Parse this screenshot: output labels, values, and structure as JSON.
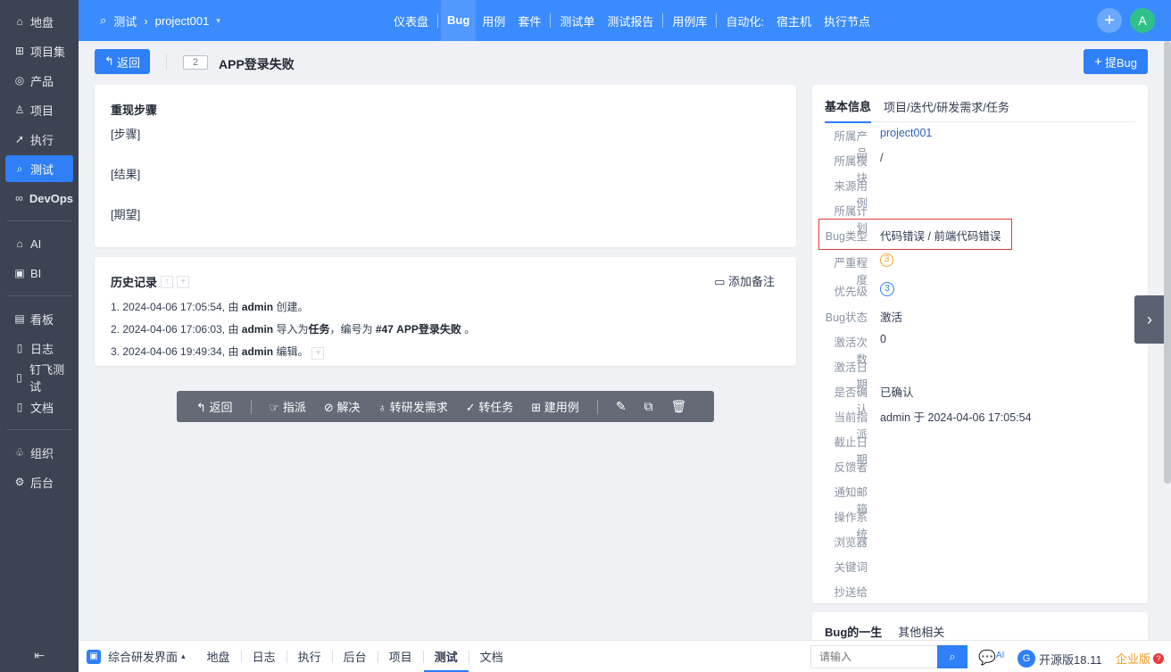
{
  "sidebar": {
    "items": [
      {
        "icon": "⌂",
        "label": "地盘"
      },
      {
        "icon": "⊞",
        "label": "项目集"
      },
      {
        "icon": "◎",
        "label": "产品"
      },
      {
        "icon": "♙",
        "label": "项目"
      },
      {
        "icon": "➚",
        "label": "执行"
      },
      {
        "icon": "⌕",
        "label": "测试"
      },
      {
        "icon": "∞",
        "label": "DevOps"
      },
      {
        "icon": "⌂",
        "label": "AI"
      },
      {
        "icon": "▣",
        "label": "BI"
      },
      {
        "icon": "▤",
        "label": "看板"
      },
      {
        "icon": "▯",
        "label": "日志"
      },
      {
        "icon": "▯",
        "label": "钉飞测试"
      },
      {
        "icon": "▯",
        "label": "文档"
      },
      {
        "icon": "♧",
        "label": "组织"
      },
      {
        "icon": "⚙",
        "label": "后台"
      }
    ],
    "collapse_icon": "⇤"
  },
  "header": {
    "section": "测试",
    "project": "project001",
    "nav": [
      "仪表盘",
      "Bug",
      "用例",
      "套件",
      "测试单",
      "测试报告",
      "用例库",
      "自动化:",
      "宿主机",
      "执行节点"
    ],
    "active_nav": "Bug",
    "avatar": "A"
  },
  "titlebar": {
    "back_label": "返回",
    "bug_id": "2",
    "bug_title": "APP登录失败",
    "add_bug_label": "提Bug"
  },
  "steps": {
    "heading": "重现步骤",
    "lines": [
      "[步骤]",
      "[结果]",
      "[期望]"
    ]
  },
  "history": {
    "heading": "历史记录",
    "add_note": "添加备注",
    "entries": [
      {
        "prefix": "1. 2024-04-06 17:05:54, 由 ",
        "user": "admin",
        "suffix": " 创建。"
      },
      {
        "prefix": "2. 2024-04-06 17:06:03, 由 ",
        "user": "admin",
        "suffix": " 导入为",
        "b1": "任务",
        "mid": "，编号为 ",
        "b2": "#47 APP登录失败",
        "end": " 。"
      },
      {
        "prefix": "3. 2024-04-06 19:49:34, 由 ",
        "user": "admin",
        "suffix": " 编辑。"
      }
    ]
  },
  "actions": [
    "返回",
    "指派",
    "解决",
    "转研发需求",
    "转任务",
    "建用例"
  ],
  "info": {
    "tabs": [
      "基本信息",
      "项目/迭代/研发需求/任务"
    ],
    "fields": {
      "product_label": "所属产品",
      "product": "project001",
      "module_label": "所属模块",
      "module": "/",
      "case_label": "来源用例",
      "case": "",
      "plan_label": "所属计划",
      "plan": "",
      "type_label": "Bug类型",
      "type": "代码错误 / 前端代码错误",
      "severity_label": "严重程度",
      "severity": "3",
      "priority_label": "优先级",
      "priority": "3",
      "status_label": "Bug状态",
      "status": "激活",
      "activated_count_label": "激活次数",
      "activated_count": "0",
      "activated_date_label": "激活日期",
      "activated_date": "",
      "confirmed_label": "是否确认",
      "confirmed": "已确认",
      "assigned_label": "当前指派",
      "assigned": "admin 于 2024-04-06 17:05:54",
      "deadline_label": "截止日期",
      "deadline": "",
      "feedback_label": "反馈者",
      "feedback": "",
      "notify_label": "通知邮箱",
      "notify": "",
      "os_label": "操作系统",
      "os": "",
      "browser_label": "浏览器",
      "browser": "",
      "keywords_label": "关键词",
      "keywords": "",
      "cc_label": "抄送给",
      "cc": ""
    }
  },
  "life": {
    "tabs": [
      "Bug的一生",
      "其他相关"
    ]
  },
  "bottombar": {
    "workspace": "综合研发界面",
    "nav": [
      "地盘",
      "日志",
      "执行",
      "后台",
      "项目",
      "测试",
      "文档"
    ],
    "active": "测试",
    "search_placeholder": "请输入",
    "version": "开源版18.11",
    "enterprise": "企业版",
    "ai_badge": "AI"
  },
  "colors": {
    "primary": "#2e7ff8",
    "header": "#3a8bfd",
    "sidebar": "#3c4353",
    "highlight_box": "#e43a3a"
  }
}
